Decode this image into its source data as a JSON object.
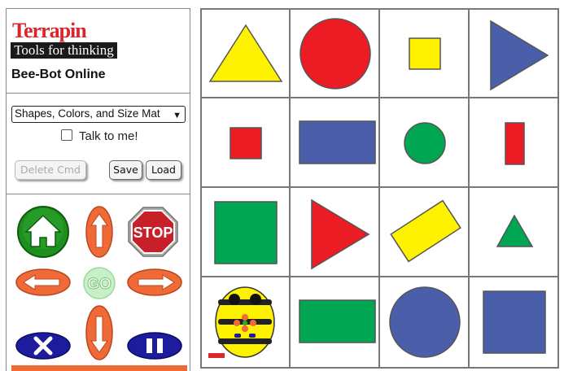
{
  "app": {
    "logo_brand": "Terrapin",
    "logo_tagline": "Tools for thinking",
    "title": "Bee-Bot Online"
  },
  "controls": {
    "mat_select_value": "Shapes, Colors, and Size Mat",
    "talk_label": "Talk to me!",
    "talk_checked": false,
    "delete_label": "Delete Cmd",
    "save_label": "Save",
    "load_label": "Load",
    "go_label": "GO",
    "stop_label": "STOP"
  },
  "mat": {
    "rows": 4,
    "cols": 4,
    "cells": [
      {
        "shape": "triangle",
        "color": "yellow",
        "size": "large"
      },
      {
        "shape": "circle",
        "color": "red",
        "size": "large"
      },
      {
        "shape": "square",
        "color": "yellow",
        "size": "small"
      },
      {
        "shape": "triangle-right",
        "color": "blue",
        "size": "large"
      },
      {
        "shape": "square",
        "color": "red",
        "size": "small"
      },
      {
        "shape": "rectangle",
        "color": "blue",
        "size": "large"
      },
      {
        "shape": "circle",
        "color": "green",
        "size": "small"
      },
      {
        "shape": "rectangle-vertical",
        "color": "red",
        "size": "small"
      },
      {
        "shape": "square",
        "color": "green",
        "size": "large"
      },
      {
        "shape": "triangle-right",
        "color": "red",
        "size": "large"
      },
      {
        "shape": "rectangle-tilted",
        "color": "yellow",
        "size": "large"
      },
      {
        "shape": "triangle",
        "color": "green",
        "size": "small"
      },
      {
        "shape": "bee-bot",
        "color": "yellow",
        "size": "robot"
      },
      {
        "shape": "rectangle",
        "color": "green",
        "size": "large"
      },
      {
        "shape": "circle",
        "color": "blue",
        "size": "large"
      },
      {
        "shape": "square",
        "color": "blue",
        "size": "large"
      }
    ]
  },
  "colors": {
    "yellow": "#fff200",
    "red": "#ec1c24",
    "blue": "#4a5eaa",
    "green": "#00a651",
    "accent_orange": "#ef6a37",
    "home_green": "#1e8f1e",
    "stop_red": "#c8202b",
    "pad_blue": "#1c1c9c"
  }
}
